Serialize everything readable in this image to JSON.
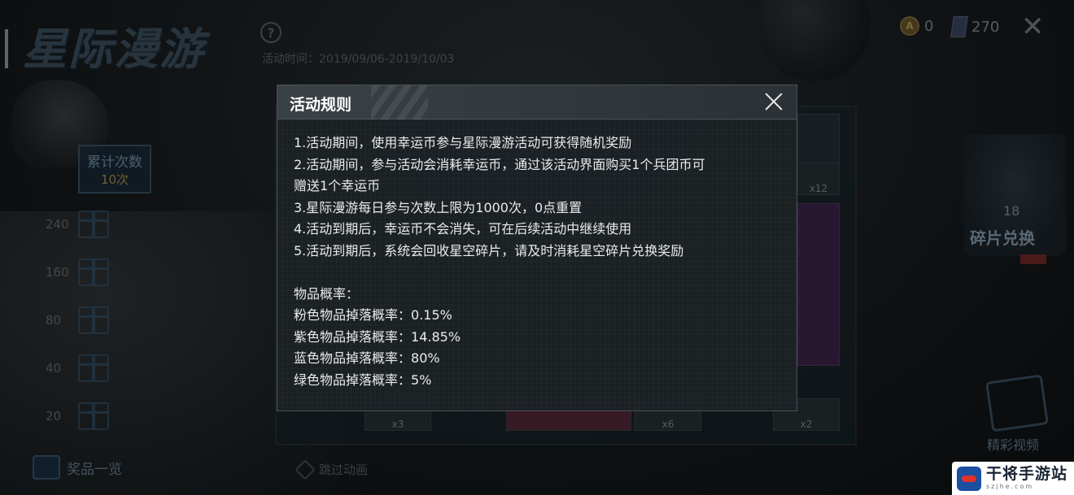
{
  "header": {
    "title": "星际漫游",
    "help_symbol": "?",
    "event_time": "活动时间：2019/09/06-2019/10/03"
  },
  "currency": {
    "coin_icon": "coin-icon",
    "coin_symbol": "A",
    "coin_count": "0",
    "card_icon": "card-icon",
    "card_count": "270"
  },
  "counter": {
    "label": "累计次数",
    "value": "10次"
  },
  "milestones": [
    "240",
    "160",
    "80",
    "40",
    "20"
  ],
  "bottom": {
    "prize_list": "奖品一览",
    "skip_animation": "跳过动画"
  },
  "grid": {
    "tile_counts": [
      "x12",
      "x3",
      "x6",
      "x2"
    ]
  },
  "right_panel": {
    "fragment_count": "18",
    "exchange_label": "碎片兑换",
    "video_label": "精彩视频"
  },
  "dialog": {
    "title": "活动规则",
    "close_icon": "close-icon",
    "rules": [
      "1.活动期间，使用幸运币参与星际漫游活动可获得随机奖励",
      "2.活动期间，参与活动会消耗幸运币，通过该活动界面购买1个兵团币可",
      "赠送1个幸运币",
      "3.星际漫游每日参与次数上限为1000次，0点重置",
      "4.活动到期后，幸运币不会消失，可在后续活动中继续使用",
      "5.活动到期后，系统会回收星空碎片，请及时消耗星空碎片兑换奖励"
    ],
    "probability_title": "物品概率：",
    "probabilities": [
      {
        "label": "粉色物品掉落概率：",
        "value": "0.15%"
      },
      {
        "label": "紫色物品掉落概率：",
        "value": "14.85%"
      },
      {
        "label": "蓝色物品掉落概率：",
        "value": "80%"
      },
      {
        "label": "绿色物品掉落概率：",
        "value": "5%"
      }
    ]
  },
  "watermark": {
    "title": "干将手游站",
    "domain": "szjhe.com"
  },
  "colors": {
    "background": "#1a1e21",
    "dialog_bg": "#1c2124",
    "accent_gold": "#b39c52",
    "accent_blue": "#3b5c78"
  }
}
